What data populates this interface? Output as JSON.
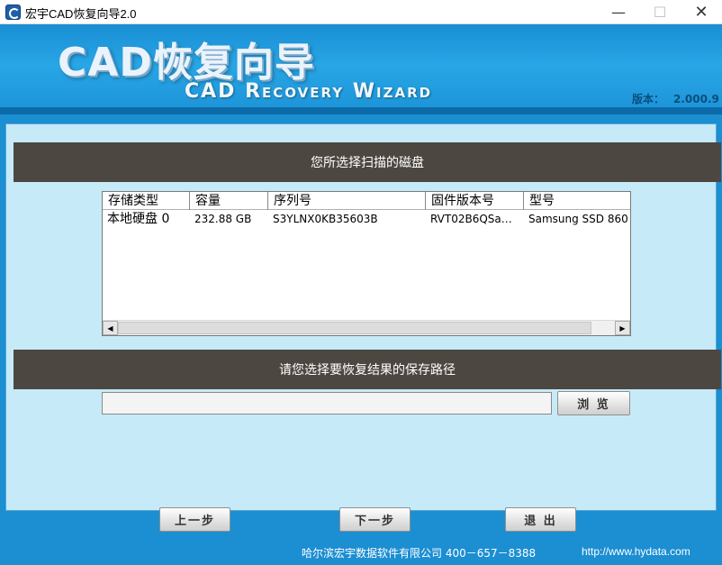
{
  "window": {
    "title": "宏宇CAD恢复向导2.0",
    "minimize_glyph": "—",
    "maximize_glyph": "☐",
    "close_glyph": "✕"
  },
  "banner": {
    "logo_cn": "CAD恢复向导",
    "logo_en": "CAD Recovery Wizard",
    "version_label": "版本：",
    "version_value": "2.000.9"
  },
  "disk_section": {
    "header": "您所选择扫描的磁盘",
    "columns": [
      "存储类型",
      "容量",
      "序列号",
      "固件版本号",
      "型号"
    ],
    "rows": [
      [
        "本地硬盘 0",
        "232.88 GB",
        "S3YLNX0KB35603B",
        "RVT02B6QSa…",
        "Samsung SSD 860"
      ]
    ],
    "scroll_left": "◀",
    "scroll_right": "▶"
  },
  "save_section": {
    "header": "请您选择要恢复结果的保存路径",
    "path_value": "",
    "browse_label": "浏 览"
  },
  "nav": {
    "prev_label": "上一步",
    "next_label": "下一步",
    "exit_label": "退 出"
  },
  "footer": {
    "company": "哈尔滨宏宇数据软件有限公司  400－657－8388",
    "url": "http://www.hydata.com"
  },
  "colors": {
    "banner_blue": "#1c93d7",
    "panel_bg": "#c7eaf8",
    "header_bar": "#4d4742"
  }
}
